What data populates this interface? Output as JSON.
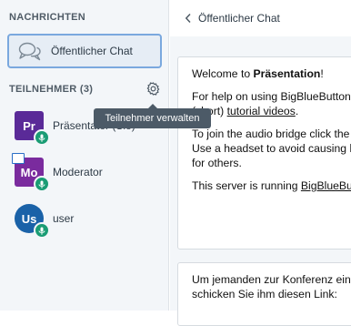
{
  "sidebar": {
    "messages_title": "NACHRICHTEN",
    "public_chat_label": "Öffentlicher Chat",
    "participants_title": "TEILNEHMER (3)",
    "manage_tooltip": "Teilnehmer verwalten",
    "users": [
      {
        "initials": "Pr",
        "name": "Präsentator (Sie)",
        "color": "#5a2a98"
      },
      {
        "initials": "Mo",
        "name": "Moderator",
        "color": "#7a2b9e"
      },
      {
        "initials": "Us",
        "name": "user",
        "color": "#1a62a8"
      }
    ]
  },
  "chat": {
    "back_label": "Öffentlicher Chat",
    "welcome": {
      "line1_pre": "Welcome to ",
      "line1_bold": "Präsentation",
      "line1_post": "!",
      "line2": "For help on using BigBlueButton see these",
      "line3_pre": "(short) ",
      "line3_link": "tutorial videos",
      "line3_post": ".",
      "line4": "To join the audio bridge click the phone button.",
      "line5": "Use a headset to avoid causing background noise",
      "line6": "for others.",
      "line7_pre": "This server is running ",
      "line7_link": "BigBlueButton"
    },
    "invite": {
      "line1": "Um jemanden zur Konferenz einzuladen,",
      "line2": "schicken Sie ihm diesen Link:"
    }
  },
  "colors": {
    "accent": "#7aa8de",
    "audio_badge": "#1a9c74",
    "tooltip_bg": "#4c5a67"
  }
}
